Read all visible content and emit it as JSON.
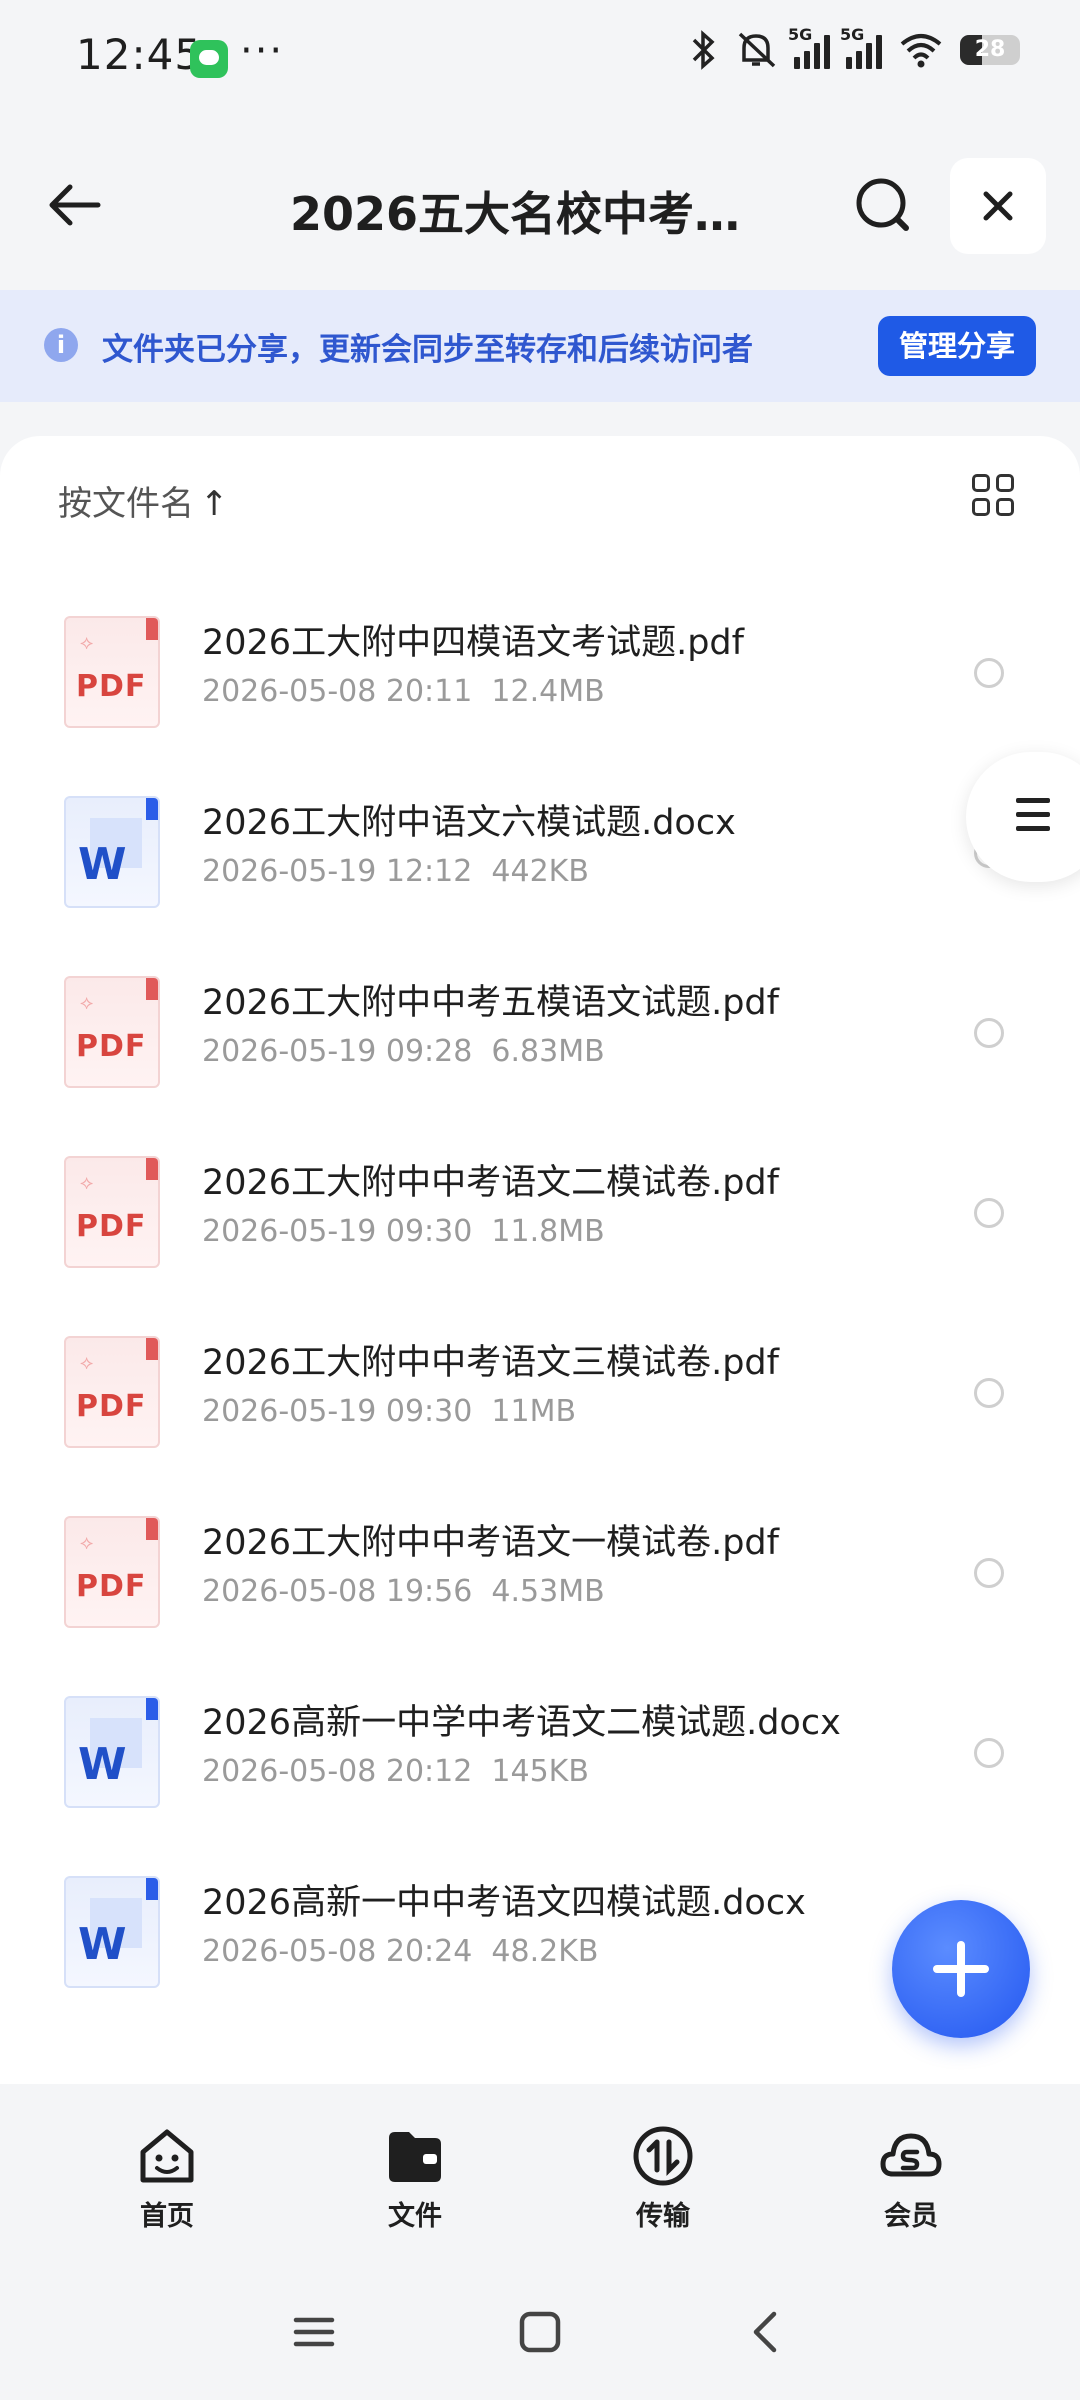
{
  "status_bar": {
    "time": "12:45",
    "more": "···",
    "network_1": "5G",
    "network_2": "5G",
    "battery": "28",
    "icons": [
      "wechat-icon",
      "bluetooth-icon",
      "mute-icon",
      "signal-icon",
      "wifi-icon",
      "battery-icon"
    ]
  },
  "header": {
    "title": "2026五大名校中考语...",
    "back_icon": "arrow-left-icon",
    "search_icon": "search-icon",
    "close_icon": "close-icon"
  },
  "banner": {
    "text": "文件夹已分享，更新会同步至转存和后续访问者",
    "button": "管理分享",
    "icon": "info-icon"
  },
  "toolbar": {
    "sort_label": "按文件名",
    "sort_arrow": "↑",
    "view_icon": "grid-view-icon"
  },
  "files": [
    {
      "name": "2026工大附中四模语文考试题.pdf",
      "date": "2026-05-08 20:11",
      "size": "12.4MB",
      "type": "pdf",
      "type_label": "PDF"
    },
    {
      "name": "2026工大附中语文六模试题.docx",
      "date": "2026-05-19 12:12",
      "size": "442KB",
      "type": "doc",
      "type_label": "W"
    },
    {
      "name": "2026工大附中中考五模语文试题.pdf",
      "date": "2026-05-19 09:28",
      "size": "6.83MB",
      "type": "pdf",
      "type_label": "PDF"
    },
    {
      "name": "2026工大附中中考语文二模试卷.pdf",
      "date": "2026-05-19 09:30",
      "size": "11.8MB",
      "type": "pdf",
      "type_label": "PDF"
    },
    {
      "name": "2026工大附中中考语文三模试卷.pdf",
      "date": "2026-05-19 09:30",
      "size": "11MB",
      "type": "pdf",
      "type_label": "PDF"
    },
    {
      "name": "2026工大附中中考语文一模试卷.pdf",
      "date": "2026-05-08 19:56",
      "size": "4.53MB",
      "type": "pdf",
      "type_label": "PDF"
    },
    {
      "name": "2026高新一中学中考语文二模试题.docx",
      "date": "2026-05-08 20:12",
      "size": "145KB",
      "type": "doc",
      "type_label": "W"
    },
    {
      "name": "2026高新一中中考语文四模试题.docx",
      "date": "2026-05-08 20:24",
      "size": "48.2KB",
      "type": "doc",
      "type_label": "W"
    }
  ],
  "side_handle_icon": "menu-icon",
  "fab_icon": "plus-icon",
  "bottom_nav": [
    {
      "label": "首页",
      "icon": "home-face-icon"
    },
    {
      "label": "文件",
      "icon": "folder-icon"
    },
    {
      "label": "传输",
      "icon": "transfer-icon"
    },
    {
      "label": "会员",
      "icon": "vip-cloud-icon"
    }
  ],
  "system_nav": [
    "recents-icon",
    "home-icon",
    "back-icon"
  ],
  "colors": {
    "accent": "#1f5ae6",
    "banner_bg": "#e6ebfb",
    "banner_text": "#2f57cf",
    "pdf_red": "#d8453f",
    "word_blue": "#2050c8"
  }
}
